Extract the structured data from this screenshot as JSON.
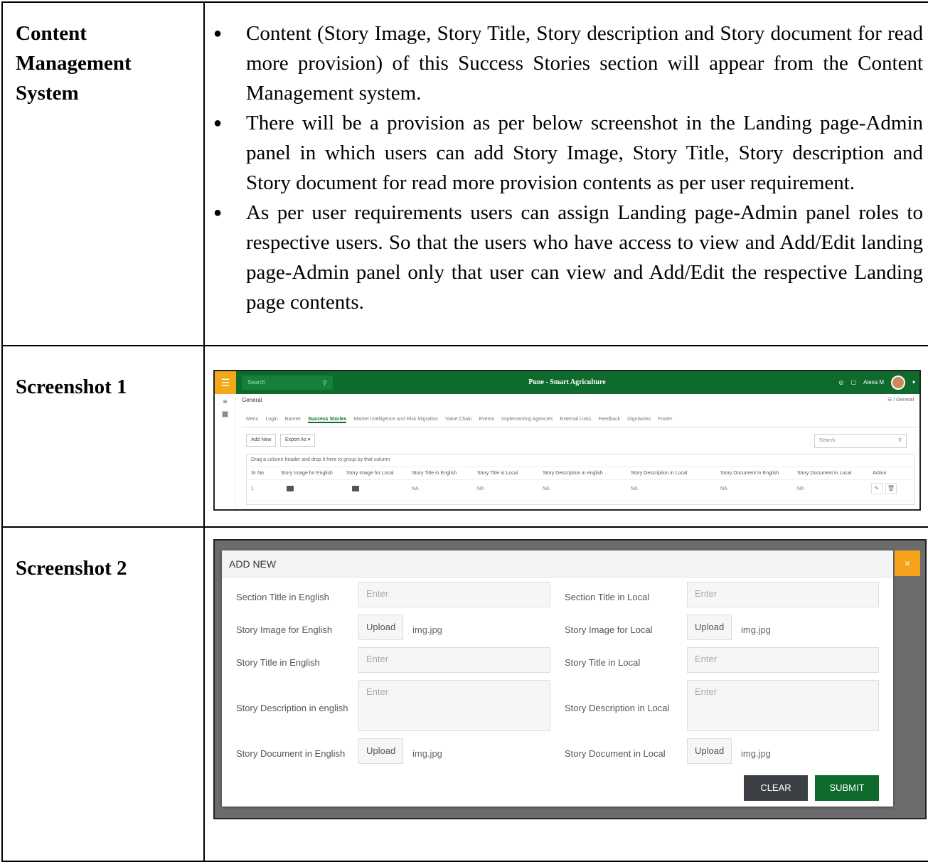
{
  "doc": {
    "row1_label": "Content Management System",
    "row2_label": "Screenshot 1",
    "row3_label": "Screenshot 2",
    "bullets": [
      "Content (Story Image, Story Title, Story description and Story document for read more provision) of this Success Stories section will appear from the Content Management system.",
      "There will be a provision as per below screenshot in the Landing page-Admin panel in which users can add Story Image, Story Title, Story description and Story document for read more provision contents as per user requirement.",
      "As per user requirements users can assign Landing page-Admin panel roles to respective users. So that the users who have access to view and Add/Edit landing page-Admin panel only that user can view and Add/Edit the respective Landing page contents."
    ]
  },
  "shot1": {
    "search_placeholder": "Search",
    "app_title": "Pune - Smart Agriculture",
    "user_name": "Alexa M",
    "page_title": "General",
    "breadcrumb": "/ General",
    "tabs": [
      "Menu",
      "Login",
      "Banner",
      "Success Stories",
      "Market Intelligence and Risk Migration",
      "Value Chain",
      "Events",
      "Implementing Agencies",
      "External Links",
      "Feedback",
      "Dignitaries",
      "Footer"
    ],
    "active_tab": "Success Stories",
    "add_new": "Add New",
    "export_as": "Export As ▾",
    "table_search": "Search",
    "group_hint": "Drag a column header and drop it here to group by that column",
    "columns": [
      "Sr No",
      "Story Image for English",
      "Story Image for Local",
      "Story Title in English",
      "Story Title in Local",
      "Story Description in english",
      "Story Description in Local",
      "Story Document in English",
      "Story Document in Local",
      "Action"
    ],
    "row": [
      "1",
      "",
      "",
      "NA",
      "NA",
      "NA",
      "NA",
      "NA",
      "NA",
      ""
    ]
  },
  "shot2": {
    "title": "ADD NEW",
    "close": "×",
    "section_title_en": "Section Title in English",
    "section_title_local": "Section Title in Local",
    "story_image_en": "Story Image for English",
    "story_image_local": "Story Image for Local",
    "story_title_en": "Story Title in English",
    "story_title_local": "Story Title in Local",
    "story_desc_en": "Story Description in english",
    "story_desc_local": "Story Description in Local",
    "story_doc_en": "Story Document in English",
    "story_doc_local": "Story Document in Local",
    "placeholder": "Enter",
    "upload": "Upload",
    "file_name": "img.jpg",
    "clear": "CLEAR",
    "submit": "SUBMIT"
  },
  "colors": {
    "brand_green": "#0e6b2d",
    "accent_orange": "#f6a31b"
  }
}
